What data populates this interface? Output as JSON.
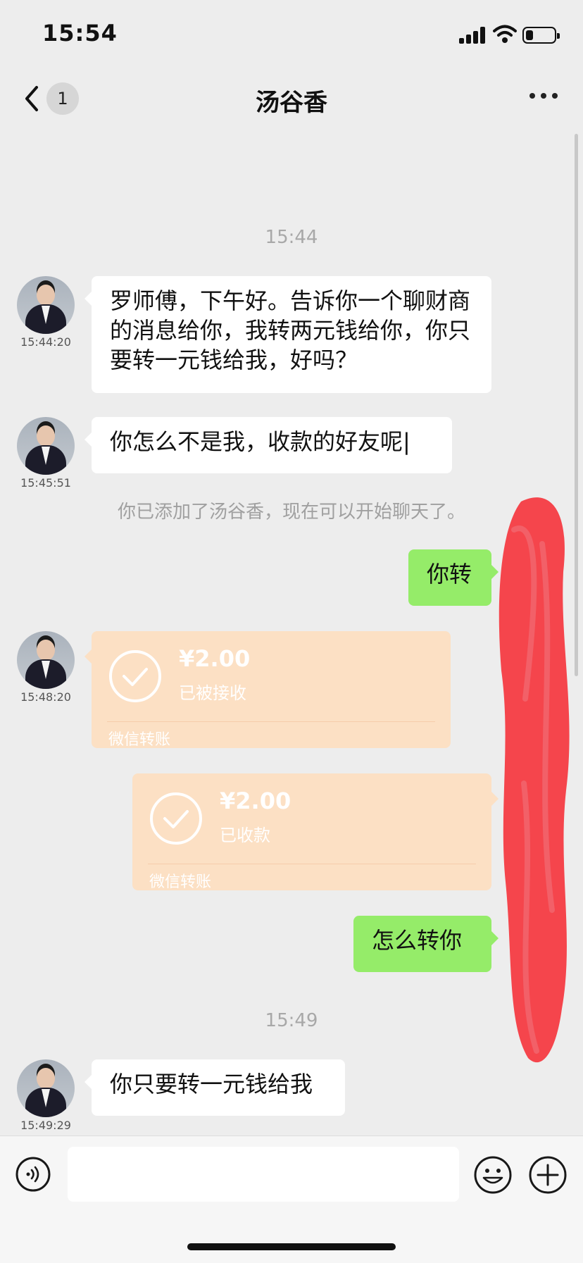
{
  "status_bar": {
    "time": "15:54"
  },
  "nav": {
    "unread_count": "1",
    "title": "汤谷香"
  },
  "conversation": {
    "time_separators": [
      "15:44",
      "15:49"
    ],
    "messages": [
      {
        "sender": "contact",
        "time": "15:44:20",
        "text": "罗师傅，下午好。告诉你一个聊财商的消息给你，我转两元钱给你，你只要转一元钱给我，好吗？"
      },
      {
        "sender": "contact",
        "time": "15:45:51",
        "text": "你怎么不是我，收款的好友呢|"
      },
      {
        "sender": "system",
        "text": "你已添加了汤谷香，现在可以开始聊天了。"
      },
      {
        "sender": "me",
        "text": "你转"
      },
      {
        "sender": "contact",
        "time": "15:48:20",
        "type": "transfer",
        "amount": "¥2.00",
        "status": "已被接收",
        "footer": "微信转账"
      },
      {
        "sender": "me",
        "type": "transfer",
        "amount": "¥2.00",
        "status": "已收款",
        "footer": "微信转账"
      },
      {
        "sender": "me",
        "text": "怎么转你"
      },
      {
        "sender": "contact",
        "time": "15:49:29",
        "text": "你只要转一元钱给我"
      }
    ]
  },
  "colors": {
    "background": "#ededed",
    "incoming_bubble": "#ffffff",
    "outgoing_bubble": "#95ec69",
    "transfer_card": "#fce0c4",
    "redaction": "#f5454c"
  }
}
